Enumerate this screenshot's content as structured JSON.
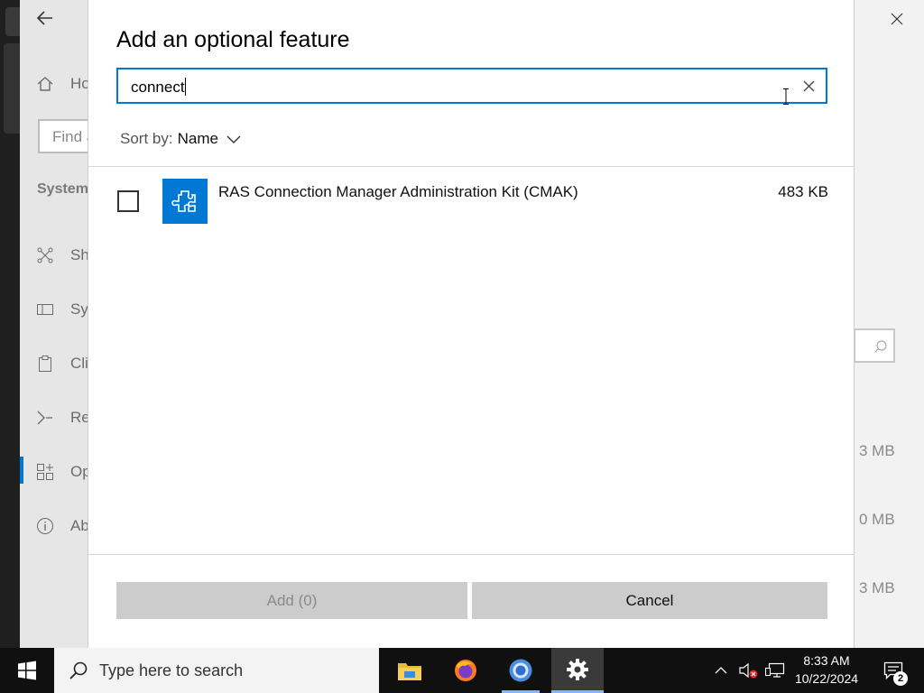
{
  "background_settings": {
    "nav_home": "Ho",
    "find_placeholder": "Find a",
    "section_label": "System",
    "nav_items": [
      "Sh",
      "Sy",
      "Cli",
      "Re",
      "Op",
      "Ab"
    ],
    "sizes": [
      "3 MB",
      "0 MB",
      "3 MB"
    ]
  },
  "dialog": {
    "title": "Add an optional feature",
    "search_value": "connect",
    "sort_label": "Sort by:",
    "sort_value": "Name",
    "features": [
      {
        "name": "RAS Connection Manager Administration Kit (CMAK)",
        "size": "483 KB",
        "checked": false
      }
    ],
    "add_button": "Add (0)",
    "cancel_button": "Cancel"
  },
  "taskbar": {
    "search_placeholder": "Type here to search",
    "time": "8:33 AM",
    "date": "10/22/2024",
    "notification_count": "2"
  },
  "colors": {
    "accent": "#0078d4",
    "button_bg": "#cccccc",
    "taskbar_bg": "#101010"
  }
}
